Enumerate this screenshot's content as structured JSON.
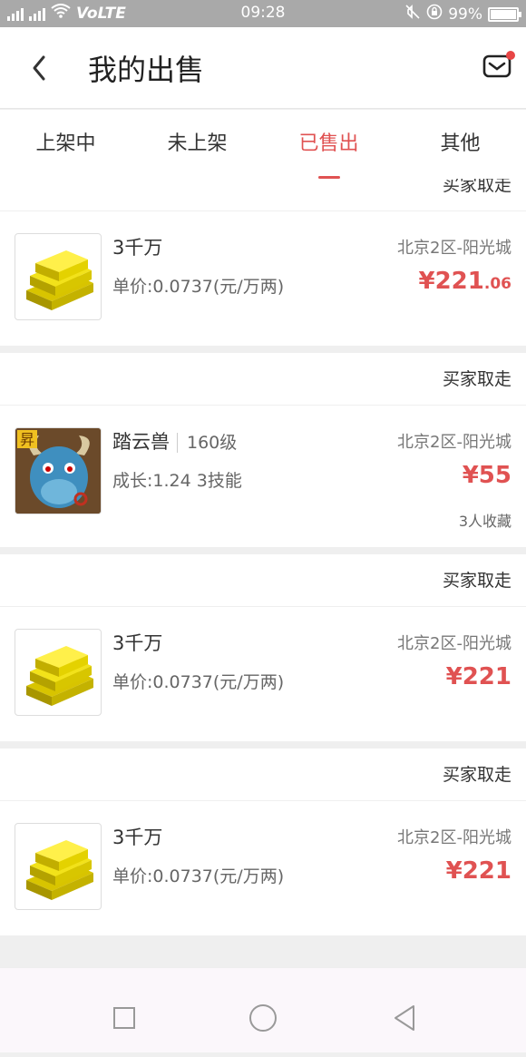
{
  "status": {
    "time": "09:28",
    "network": "VoLTE",
    "battery": "99%"
  },
  "header": {
    "title": "我的出售"
  },
  "tabs": [
    "上架中",
    "未上架",
    "已售出",
    "其他"
  ],
  "top_partial_label": "买家取走",
  "items": [
    {
      "status": "",
      "name": "3千万",
      "level": "",
      "sub": "单价:0.0737(元/万两)",
      "server": "北京2区-阳光城",
      "price_main": "¥221",
      "price_dec": ".06",
      "fav": "",
      "thumb": "gold"
    },
    {
      "status": "买家取走",
      "name": "踏云兽",
      "level": "160级",
      "sub": "成长:1.24 3技能",
      "server": "北京2区-阳光城",
      "price_main": "¥55",
      "price_dec": "",
      "fav": "3人收藏",
      "thumb": "pet"
    },
    {
      "status": "买家取走",
      "name": "3千万",
      "level": "",
      "sub": "单价:0.0737(元/万两)",
      "server": "北京2区-阳光城",
      "price_main": "¥221",
      "price_dec": "",
      "fav": "",
      "thumb": "gold"
    },
    {
      "status": "买家取走",
      "name": "3千万",
      "level": "",
      "sub": "单价:0.0737(元/万两)",
      "server": "北京2区-阳光城",
      "price_main": "¥221",
      "price_dec": "",
      "fav": "",
      "thumb": "gold"
    }
  ],
  "colors": {
    "accent": "#e05252",
    "statusbar": "#a9a9a9"
  }
}
